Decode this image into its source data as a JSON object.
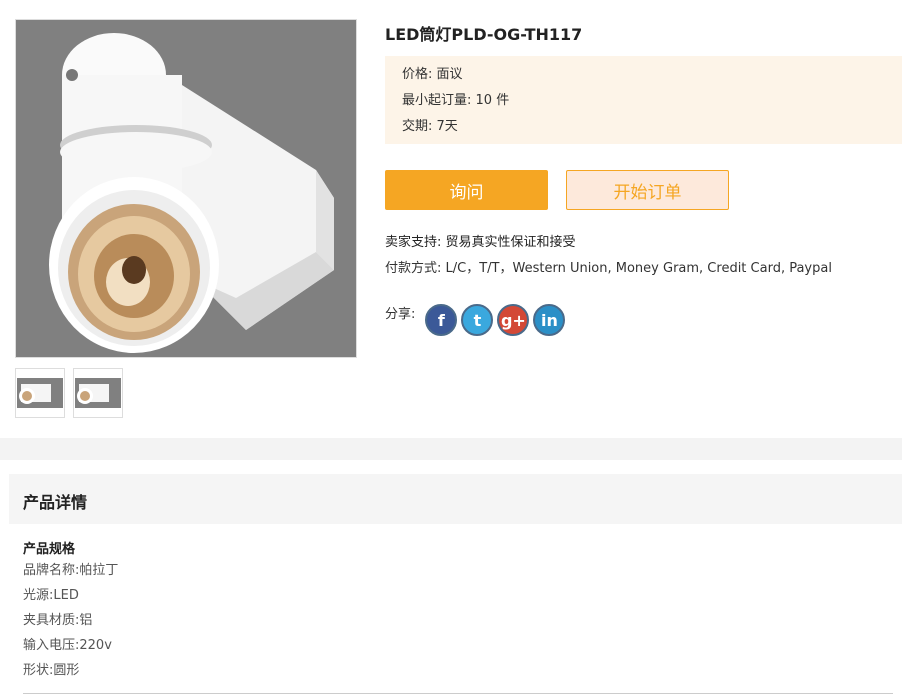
{
  "product": {
    "title": "LED筒灯PLD-OG-TH117",
    "main_image_alt": "product-photo",
    "thumbnails": [
      "thumb-1",
      "thumb-2"
    ]
  },
  "price_box": {
    "price_label": "价格:",
    "price_value": "面议",
    "moq_label": "最小起订量:",
    "moq_value": "10 件",
    "delivery_label": "交期:",
    "delivery_value": "7天"
  },
  "buttons": {
    "inquire": "询问",
    "start_order": "开始订单"
  },
  "support": {
    "label": "卖家支持:",
    "value": "贸易真实性保证和接受"
  },
  "payment": {
    "label": "付款方式:",
    "value": "L/C，T/T，Western Union, Money Gram, Credit Card, Paypal"
  },
  "share": {
    "label": "分享:",
    "icons": [
      {
        "name": "facebook-icon",
        "glyph": "f"
      },
      {
        "name": "twitter-icon",
        "glyph": "t"
      },
      {
        "name": "google-plus-icon",
        "glyph": "g+"
      },
      {
        "name": "linkedin-icon",
        "glyph": "in"
      }
    ]
  },
  "details": {
    "section_title": "产品详情",
    "spec_heading": "产品规格",
    "specs": [
      {
        "label": "品牌名称:",
        "value": "帕拉丁"
      },
      {
        "label": "光源:",
        "value": "LED"
      },
      {
        "label": "夹具材质:",
        "value": "铝"
      },
      {
        "label": "输入电压:",
        "value": "220v"
      },
      {
        "label": "形状:",
        "value": "圆形"
      }
    ]
  },
  "colors": {
    "accent": "#f5a623",
    "price_bg": "#fdf4e8",
    "image_bg": "#808080"
  }
}
